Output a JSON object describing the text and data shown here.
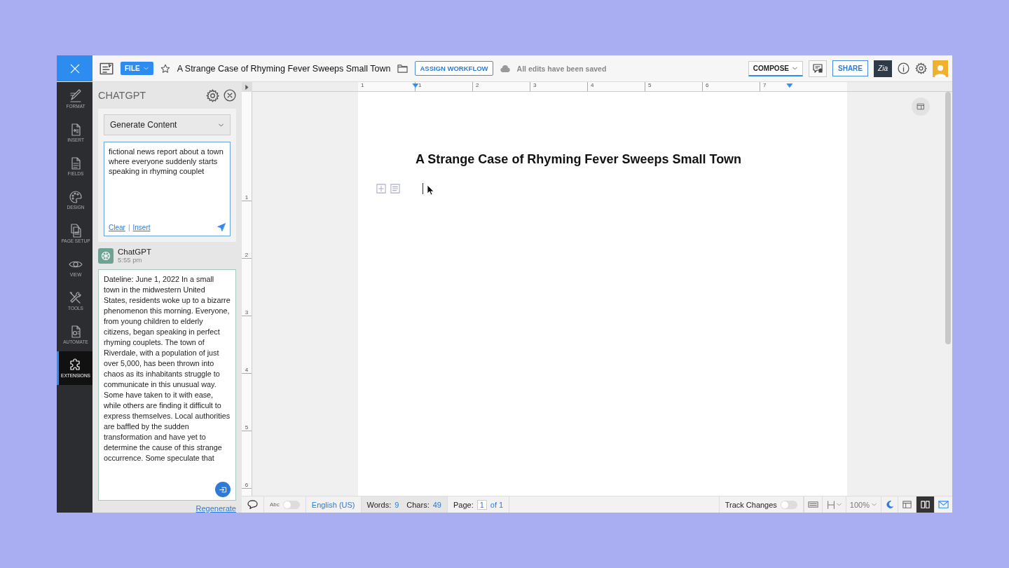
{
  "toolbar": {
    "file_button": "FILE",
    "title": "A Strange Case of Rhyming Fever Sweeps Small Town",
    "assign_button": "ASSIGN WORKFLOW",
    "save_status": "All edits have been saved",
    "compose_button": "COMPOSE",
    "share_button": "SHARE",
    "zia_button": "Zia"
  },
  "rail": [
    {
      "label": "FORMAT",
      "selected": false
    },
    {
      "label": "INSERT",
      "selected": false
    },
    {
      "label": "FIELDS",
      "selected": false
    },
    {
      "label": "DESIGN",
      "selected": false
    },
    {
      "label": "PAGE SETUP",
      "selected": false
    },
    {
      "label": "VIEW",
      "selected": false
    },
    {
      "label": "TOOLS",
      "selected": false
    },
    {
      "label": "AUTOMATE",
      "selected": false
    },
    {
      "label": "EXTENSIONS",
      "selected": true
    }
  ],
  "panel": {
    "title": "CHATGPT",
    "mode": "Generate Content",
    "prompt": "fictional news report about a town where everyone suddenly starts speaking in rhyming couplet",
    "clear_link": "Clear",
    "link_separator": "|",
    "insert_link": "Insert",
    "message": {
      "sender": "ChatGPT",
      "time": "5:55 pm",
      "text": "Dateline: June 1, 2022 In a small town in the midwestern United States, residents woke up to a bizarre phenomenon this morning. Everyone, from young children to elderly citizens, began speaking in perfect rhyming couplets. The town of Riverdale, with a population of just over 5,000, has been thrown into chaos as its inhabitants struggle to communicate in this unusual way. Some have taken to it with ease, while others are finding it difficult to express themselves. Local authorities are baffled by the sudden transformation and have yet to determine the cause of this strange occurrence. Some speculate that"
    },
    "regenerate_link": "Regenerate"
  },
  "ruler": {
    "horizontal": [
      "1",
      "1",
      "2",
      "3",
      "4",
      "5",
      "6",
      "7"
    ],
    "vertical": [
      "1",
      "2",
      "3",
      "4",
      "5",
      "6"
    ]
  },
  "document": {
    "heading": "A Strange Case of Rhyming Fever Sweeps Small Town"
  },
  "status_bar": {
    "spellcheck_label": "Abc",
    "spellcheck_on": false,
    "language": "English (US)",
    "words_label": "Words:",
    "words": "9",
    "chars_label": "Chars:",
    "chars": "49",
    "page_label": "Page:",
    "page": "1",
    "page_total": "of 1",
    "track_changes_label": "Track Changes",
    "track_changes_on": false,
    "zoom": "100%"
  }
}
